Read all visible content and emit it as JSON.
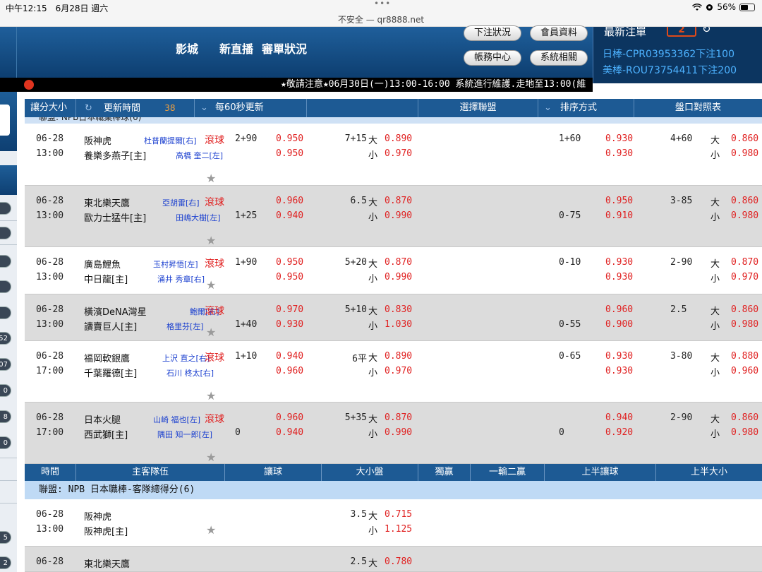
{
  "status_bar": {
    "time": "中午12:15　6月28日 週六",
    "dots": "•••",
    "url": "不安全 — qr8888.net",
    "battery": "56%"
  },
  "header": {
    "nav": [
      "影城",
      "新直播",
      "審單狀況"
    ],
    "buttons": {
      "bet_status": "下注狀況",
      "member_info": "會員資料",
      "account_center": "帳務中心",
      "system": "系統相關"
    },
    "latest": {
      "title": "最新注單",
      "count": "2",
      "refresh_icon": "↻",
      "lines": [
        "日棒-CPR03953362下注100",
        "美棒-ROU73754411下注200"
      ]
    }
  },
  "marquee": "★敬請注意★06月30日(一)13:00-16:00 系統進行維護.走地至13:00(維",
  "toolbar": {
    "handicap": "讓分大小",
    "refresh_icon": "↻",
    "update_time": "更新時間",
    "seconds": "38",
    "every": "每60秒更新",
    "select_league": "選擇聯盟",
    "sort": "排序方式",
    "compare": "盤口對照表"
  },
  "league1_cut": "聯盟: NPB日本職業棒球(6)",
  "games": [
    {
      "date": "06-28",
      "time": "13:00",
      "home": "阪神虎",
      "home_pitcher": "杜普蘭提爾[右]",
      "away": "養樂多燕子[主]",
      "away_pitcher": "高橋 奎二[左]",
      "live": "滾球",
      "h1_line": "2+90",
      "h2_line": "",
      "o1": "0.950",
      "o2": "0.950",
      "ou1_line": "7+15",
      "ou1_side": "大",
      "ou1": "0.890",
      "ou2_line": "",
      "ou2_side": "小",
      "ou2": "0.970",
      "fh1_line": "1+60",
      "fh2_line": "",
      "fh1": "0.930",
      "fh2": "0.930",
      "fou_line": "4+60",
      "fou1_side": "大",
      "fou1": "0.860",
      "fou2_side": "小",
      "fou2": "0.980"
    },
    {
      "date": "06-28",
      "time": "13:00",
      "home": "東北樂天鷹",
      "home_pitcher": "亞胡雷[右]",
      "away": "歐力士猛牛[主]",
      "away_pitcher": "田嶋大樹[左]",
      "live": "滾球",
      "h1_line": "",
      "h2_line": "1+25",
      "o1": "0.960",
      "o2": "0.940",
      "ou1_line": "6.5",
      "ou1_side": "大",
      "ou1": "0.870",
      "ou2_line": "",
      "ou2_side": "小",
      "ou2": "0.990",
      "fh1_line": "",
      "fh2_line": "0-75",
      "fh1": "0.950",
      "fh2": "0.910",
      "fou_line": "3-85",
      "fou1_side": "大",
      "fou1": "0.860",
      "fou2_side": "小",
      "fou2": "0.980"
    },
    {
      "date": "06-28",
      "time": "13:00",
      "home": "廣島鯉魚",
      "home_pitcher": "玉村昇悟[左]",
      "away": "中日龍[主]",
      "away_pitcher": "涌井 秀章[右]",
      "live": "滾球",
      "h1_line": "1+90",
      "h2_line": "",
      "o1": "0.950",
      "o2": "0.950",
      "ou1_line": "5+20",
      "ou1_side": "大",
      "ou1": "0.870",
      "ou2_line": "",
      "ou2_side": "小",
      "ou2": "0.990",
      "fh1_line": "0-10",
      "fh2_line": "",
      "fh1": "0.930",
      "fh2": "0.930",
      "fou_line": "2-90",
      "fou1_side": "大",
      "fou1": "0.870",
      "fou2_side": "小",
      "fou2": "0.970"
    },
    {
      "date": "06-28",
      "time": "13:00",
      "home": "橫濱DeNA灣星",
      "home_pitcher": "鮑爾[右]",
      "away": "讀賣巨人[主]",
      "away_pitcher": "格里芬[左]",
      "live": "滾球",
      "h1_line": "",
      "h2_line": "1+40",
      "o1": "0.970",
      "o2": "0.930",
      "ou1_line": "5+10",
      "ou1_side": "大",
      "ou1": "0.830",
      "ou2_line": "",
      "ou2_side": "小",
      "ou2": "1.030",
      "fh1_line": "",
      "fh2_line": "0-55",
      "fh1": "0.960",
      "fh2": "0.900",
      "fou_line": "2.5",
      "fou1_side": "大",
      "fou1": "0.860",
      "fou2_side": "小",
      "fou2": "0.980"
    },
    {
      "date": "06-28",
      "time": "17:00",
      "home": "福岡軟銀鷹",
      "home_pitcher": "上沢 直之[右]",
      "away": "千葉羅德[主]",
      "away_pitcher": "石川 柊太[右]",
      "live": "滾球",
      "h1_line": "1+10",
      "h2_line": "",
      "o1": "0.940",
      "o2": "0.960",
      "ou1_line": "6平",
      "ou1_side": "大",
      "ou1": "0.890",
      "ou2_line": "",
      "ou2_side": "小",
      "ou2": "0.970",
      "fh1_line": "0-65",
      "fh2_line": "",
      "fh1": "0.930",
      "fh2": "0.930",
      "fou_line": "3-80",
      "fou1_side": "大",
      "fou1": "0.880",
      "fou2_side": "小",
      "fou2": "0.960"
    },
    {
      "date": "06-28",
      "time": "17:00",
      "home": "日本火腿",
      "home_pitcher": "山崎 福也[左]",
      "away": "西武獅[主]",
      "away_pitcher": "隅田 知一郎[左]",
      "live": "滾球",
      "h1_line": "",
      "h2_line": "0",
      "o1": "0.960",
      "o2": "0.940",
      "ou1_line": "5+35",
      "ou1_side": "大",
      "ou1": "0.870",
      "ou2_line": "",
      "ou2_side": "小",
      "ou2": "0.990",
      "fh1_line": "",
      "fh2_line": "0",
      "fh1": "0.940",
      "fh2": "0.920",
      "fou_line": "2-90",
      "fou1_side": "大",
      "fou1": "0.860",
      "fou2_side": "小",
      "fou2": "0.980"
    }
  ],
  "table2_headers": [
    "時間",
    "主客隊伍",
    "讓球",
    "大小盤",
    "獨贏",
    "一輸二贏",
    "上半讓球",
    "上半大小"
  ],
  "league2": "聯盟: NPB 日本職棒-客隊總得分(6)",
  "games2": [
    {
      "date": "06-28",
      "time": "13:00",
      "home": "阪神虎",
      "away": "阪神虎[主]",
      "ou_line": "3.5",
      "ou1_side": "大",
      "ou1": "0.715",
      "ou2_side": "小",
      "ou2": "1.125"
    },
    {
      "date": "06-28",
      "time": "",
      "home": "東北樂天鷹",
      "away": "",
      "ou_line": "2.5",
      "ou1_side": "大",
      "ou1": "0.780",
      "ou2_side": "",
      "ou2": ""
    }
  ],
  "sidebar_pills": [
    "",
    "",
    "",
    "",
    "",
    "52",
    "07",
    "0",
    "8",
    "0",
    "5",
    "2"
  ],
  "icons": {
    "wifi": "wifi-icon",
    "star": "★",
    "arrow": "⌄"
  }
}
